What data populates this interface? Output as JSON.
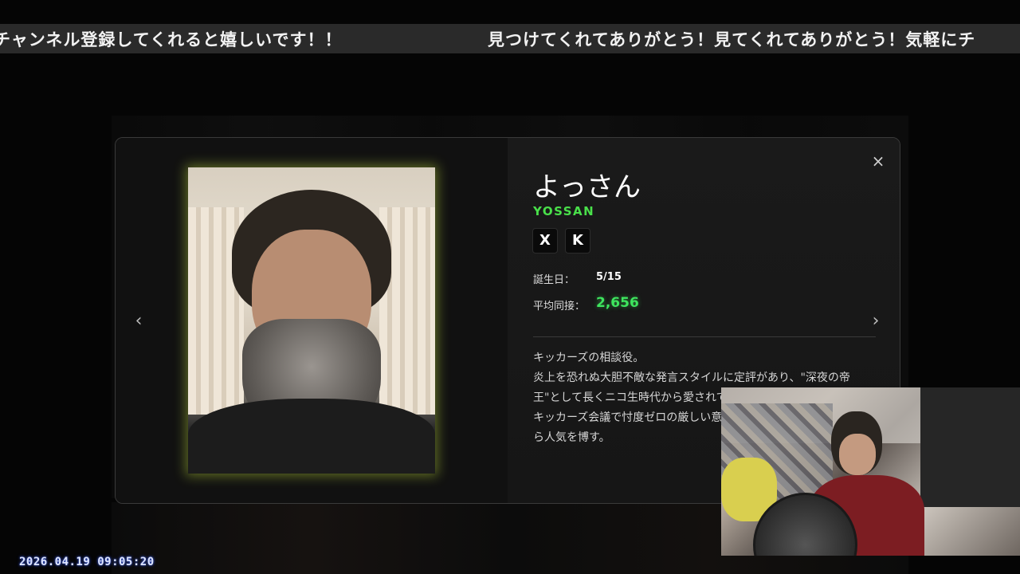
{
  "ticker": {
    "segment1": "チャンネル登録してくれると嬉しいです！！",
    "segment2": "見つけてくれてありがとう！見てくれてありがとう！気軽にチ"
  },
  "modal": {
    "name_ja": "よっさん",
    "name_roman": "YOSSAN",
    "social": {
      "x_icon": "X",
      "k_icon": "K"
    },
    "birthday_label": "誕生日：",
    "birthday_value": "5/15",
    "avg_label": "平均同接：",
    "avg_value": "2,656",
    "accent_color": "#49e04a",
    "description": [
      "キッカーズの相談役。",
      "炎上を恐れぬ大胆不敵な発言スタイルに定評があり、\"深夜の帝",
      "王\"として長くニコ生時代から愛されて",
      "キッカーズ会議で忖度ゼロの厳しい意",
      "ら人気を博す。"
    ],
    "close_glyph": "×",
    "prev_glyph": "‹",
    "next_glyph": "›"
  },
  "overlay": {
    "timestamp": "2026.04.19 09:05:20"
  }
}
